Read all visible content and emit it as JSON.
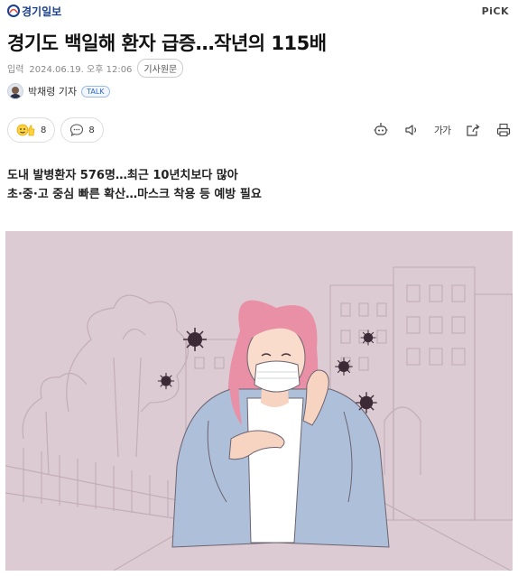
{
  "header": {
    "logo_text": "경기일보",
    "pick_label": "PiCK"
  },
  "article": {
    "title": "경기도 백일해 환자 급증…작년의 115배",
    "input_label": "입력",
    "input_datetime": "2024.06.19. 오후 12:06",
    "origin_button": "기사원문",
    "author": "박채령 기자",
    "talk_badge": "TALK",
    "subtitle_lines": [
      "도내 발병환자 576명…최근 10년치보다 많아",
      "초·중·고 중심 빠른 확산…마스크 착용 등 예방 필요"
    ]
  },
  "reactions": {
    "like_count": "8",
    "comment_count": "8"
  },
  "toolbar": {
    "icons": [
      "robot-summary-icon",
      "speaker-icon",
      "font-size-icon",
      "share-icon",
      "print-icon"
    ],
    "font_label": "가가"
  },
  "colors": {
    "logo_blue": "#1b3f8f",
    "image_bg": "#dccbd3",
    "hair_pink": "#e98fa6",
    "jacket_blue": "#aebfd9",
    "virus_dark": "#3c2a36"
  }
}
